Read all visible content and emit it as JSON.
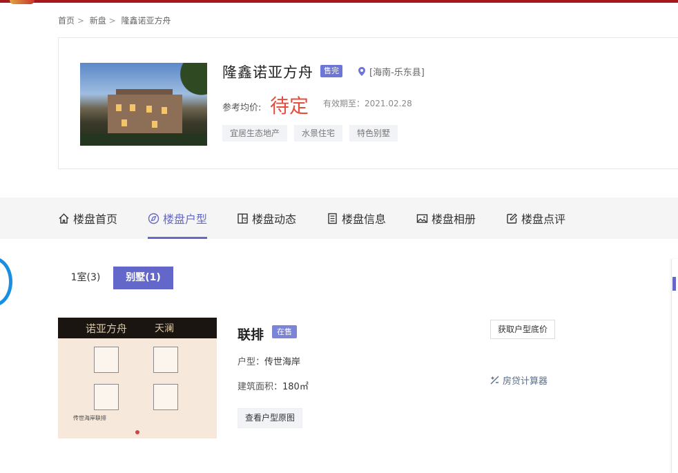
{
  "breadcrumb": {
    "items": [
      "首页",
      "新盘",
      "隆鑫诺亚方舟"
    ],
    "separator": ">"
  },
  "project": {
    "name": "隆鑫诺亚方舟",
    "status_badge": "售完",
    "location": "[海南-乐东县]",
    "price_label": "参考均价:",
    "price_value": "待定",
    "valid_until": "有效期至：2021.02.28",
    "tags": [
      "宜居生态地产",
      "水景住宅",
      "特色别墅"
    ]
  },
  "nav": {
    "tabs": [
      {
        "label": "楼盘首页",
        "icon": "home-icon"
      },
      {
        "label": "楼盘户型",
        "icon": "layout-icon",
        "active": true
      },
      {
        "label": "楼盘动态",
        "icon": "news-icon"
      },
      {
        "label": "楼盘信息",
        "icon": "list-icon"
      },
      {
        "label": "楼盘相册",
        "icon": "image-icon"
      },
      {
        "label": "楼盘点评",
        "icon": "edit-icon"
      }
    ]
  },
  "filters": {
    "room": "1室(3)",
    "villa": "别墅(1)"
  },
  "unit": {
    "title": "联排",
    "status_badge": "在售",
    "type_label": "户型：",
    "type_value": "传世海岸",
    "area_label": "建筑面积：",
    "area_value": "180㎡",
    "view_button": "查看户型原图",
    "price_button": "获取户型底价",
    "calculator": "房贷计算器",
    "plan_header_left": "诺亚方舟",
    "plan_header_right": "天澜",
    "plan_caption": "传世海岸联排"
  },
  "colors": {
    "accent": "#6568c7",
    "price": "#e84c3d",
    "top_bar": "#a5191c"
  }
}
